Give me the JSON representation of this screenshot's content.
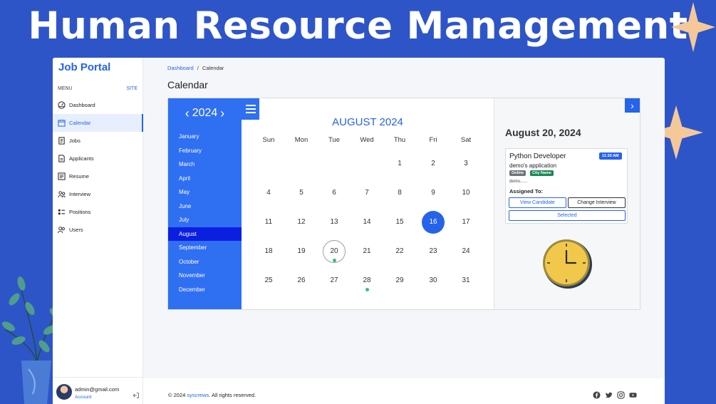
{
  "banner_title": "Human Resource Management",
  "sidebar": {
    "brand": "Job Portal",
    "menu_label": "MENU",
    "site_link": "SITE",
    "items": [
      {
        "label": "Dashboard",
        "icon": "dashboard-icon"
      },
      {
        "label": "Calendar",
        "icon": "calendar-icon",
        "active": true
      },
      {
        "label": "Jobs",
        "icon": "jobs-icon"
      },
      {
        "label": "Applicants",
        "icon": "applicants-icon"
      },
      {
        "label": "Resume",
        "icon": "resume-icon"
      },
      {
        "label": "Interview",
        "icon": "interview-icon"
      },
      {
        "label": "Positions",
        "icon": "positions-icon"
      },
      {
        "label": "Users",
        "icon": "users-icon"
      }
    ],
    "user": {
      "email": "admin@gmail.com",
      "account_label": "Account"
    }
  },
  "breadcrumb": {
    "home": "Dashboard",
    "separator": "/",
    "current": "Calendar"
  },
  "page_title": "Calendar",
  "year_picker": {
    "year": "2024",
    "prev": "‹",
    "next": "›"
  },
  "months": [
    "January",
    "February",
    "March",
    "April",
    "May",
    "June",
    "July",
    "August",
    "September",
    "October",
    "November",
    "December"
  ],
  "active_month": "August",
  "calendar": {
    "title": "AUGUST 2024",
    "weekdays": [
      "Sun",
      "Mon",
      "Tue",
      "Wed",
      "Thu",
      "Fri",
      "Sat"
    ],
    "first_weekday_index": 4,
    "days_in_month": 31,
    "selected_day": 16,
    "today_day": 20,
    "event_days": [
      20,
      28
    ]
  },
  "detail": {
    "next_arrow": "›",
    "date_heading": "August 20, 2024",
    "event": {
      "title": "Python Developer",
      "time": "11:30 AM",
      "subtitle": "demo's application",
      "badge_mode": "Online",
      "badge_location": "City Name",
      "description": "demo......",
      "assigned_label": "Assigned To:",
      "view_button": "View Candidate",
      "change_button": "Change Interview",
      "status_button": "Selected"
    }
  },
  "footer": {
    "copyright_prefix": "© 2024",
    "company": "syscrews",
    "copyright_suffix": ". All rights reserved."
  },
  "colors": {
    "primary": "#2563eb",
    "sidebar_blue": "#2f6ff2",
    "active_month": "#0b1fe0",
    "background": "#2e55c8",
    "accent": "#f5c89a",
    "event_dot": "#38c172"
  }
}
